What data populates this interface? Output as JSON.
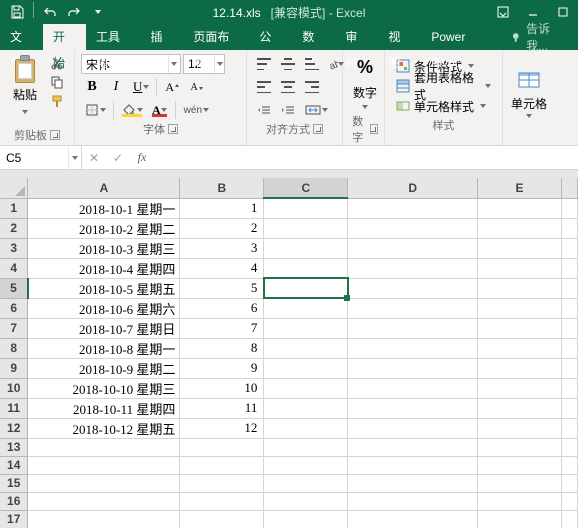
{
  "titlebar": {
    "filename": "12.14.xls",
    "compat_label": "[兼容模式]",
    "appname": "Excel"
  },
  "tabs": {
    "file": "文件",
    "home": "开始",
    "toolbox": "工具箱",
    "insert": "插入",
    "pagelayout": "页面布局",
    "formulas": "公式",
    "data": "数据",
    "review": "审阅",
    "view": "视图",
    "powerpivot": "Power Pivot",
    "tellme_placeholder": "告诉我..."
  },
  "ribbon": {
    "clipboard": {
      "paste": "粘贴",
      "group": "剪贴板"
    },
    "font": {
      "name": "宋体",
      "size": "12",
      "wen": "wén",
      "group": "字体"
    },
    "alignment": {
      "group": "对齐方式"
    },
    "number": {
      "label": "数字",
      "group": "数字"
    },
    "styles": {
      "cond": "条件格式",
      "table": "套用表格格式",
      "cell": "单元格样式",
      "group": "样式"
    },
    "cells": {
      "label": "单元格"
    }
  },
  "fxbar": {
    "namebox": "C5",
    "fx": "fx",
    "formula": ""
  },
  "grid": {
    "cols": [
      "A",
      "B",
      "C",
      "D",
      "E",
      ""
    ],
    "rows": [
      {
        "n": "1",
        "A": "2018-10-1 星期一",
        "B": "1"
      },
      {
        "n": "2",
        "A": "2018-10-2 星期二",
        "B": "2"
      },
      {
        "n": "3",
        "A": "2018-10-3 星期三",
        "B": "3"
      },
      {
        "n": "4",
        "A": "2018-10-4 星期四",
        "B": "4"
      },
      {
        "n": "5",
        "A": "2018-10-5 星期五",
        "B": "5"
      },
      {
        "n": "6",
        "A": "2018-10-6 星期六",
        "B": "6"
      },
      {
        "n": "7",
        "A": "2018-10-7 星期日",
        "B": "7"
      },
      {
        "n": "8",
        "A": "2018-10-8 星期一",
        "B": "8"
      },
      {
        "n": "9",
        "A": "2018-10-9 星期二",
        "B": "9"
      },
      {
        "n": "10",
        "A": "2018-10-10 星期三",
        "B": "10"
      },
      {
        "n": "11",
        "A": "2018-10-11 星期四",
        "B": "11"
      },
      {
        "n": "12",
        "A": "2018-10-12 星期五",
        "B": "12"
      },
      {
        "n": "13",
        "A": "",
        "B": ""
      },
      {
        "n": "14",
        "A": "",
        "B": ""
      },
      {
        "n": "15",
        "A": "",
        "B": ""
      },
      {
        "n": "16",
        "A": "",
        "B": ""
      },
      {
        "n": "17",
        "A": "",
        "B": ""
      }
    ],
    "active": {
      "row": "5",
      "col": "C"
    }
  }
}
